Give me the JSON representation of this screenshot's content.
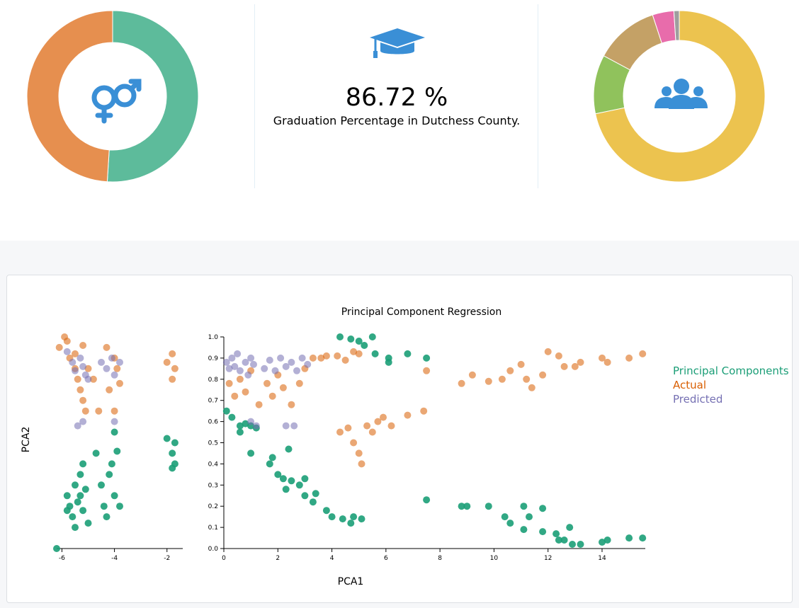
{
  "colors": {
    "gender_male": "#5dbb9b",
    "gender_female": "#e68f4f",
    "icon_blue": "#3a8fd6",
    "pc": "#1b9e77",
    "actual": "#d95f02",
    "predicted": "#7570b3"
  },
  "icons": {
    "gender": "gender-male-female-icon",
    "graduation": "graduation-cap-icon",
    "population": "users-group-icon"
  },
  "gender_donut": {
    "slices": [
      {
        "value": 51,
        "color": "#5dbb9b"
      },
      {
        "value": 49,
        "color": "#e68f4f"
      }
    ]
  },
  "graduation": {
    "percentage": "86.72 %",
    "label": "Graduation Percentage in Dutchess County."
  },
  "race_donut": {
    "slices": [
      {
        "value": 71,
        "color": "#ecc34f"
      },
      {
        "value": 11,
        "color": "#90c25c"
      },
      {
        "value": 12,
        "color": "#c4a166"
      },
      {
        "value": 4,
        "color": "#e86cab"
      },
      {
        "value": 1,
        "color": "#9e9e9e"
      }
    ]
  },
  "chart_data": {
    "type": "scatter",
    "title": "Principal Component Regression",
    "xlabel": "PCA1",
    "ylabel": "PCA2",
    "legend": {
      "placement": "right",
      "entries": [
        {
          "label": "Principal Components",
          "color": "#1b9e77"
        },
        {
          "label": "Actual",
          "color": "#d95f02"
        },
        {
          "label": "Predicted",
          "color": "#7570b3"
        }
      ]
    },
    "left_panel": {
      "xlim": [
        -6.2,
        -1.4
      ],
      "xticks": [
        "-6",
        "-4",
        "-2"
      ]
    },
    "right_panel": {
      "xlim": [
        0,
        15.6
      ],
      "ylim": [
        0,
        1.0
      ],
      "xticks": [
        "0",
        "2",
        "4",
        "6",
        "8",
        "10",
        "12",
        "14"
      ],
      "yticks": [
        "0.0",
        "0.1",
        "0.2",
        "0.3",
        "0.4",
        "0.5",
        "0.6",
        "0.7",
        "0.8",
        "0.9",
        "1.0"
      ]
    },
    "series": [
      {
        "name": "Principal Components",
        "color": "#1b9e77",
        "points": [
          [
            -6.2,
            0.0
          ],
          [
            -5.8,
            0.25
          ],
          [
            -5.7,
            0.2
          ],
          [
            -5.6,
            0.15
          ],
          [
            -5.5,
            0.3
          ],
          [
            -5.4,
            0.22
          ],
          [
            -5.3,
            0.35
          ],
          [
            -5.2,
            0.18
          ],
          [
            -5.1,
            0.28
          ],
          [
            -5.0,
            0.12
          ],
          [
            -5.2,
            0.4
          ],
          [
            -5.5,
            0.1
          ],
          [
            -5.8,
            0.18
          ],
          [
            -5.3,
            0.25
          ],
          [
            -4.7,
            0.45
          ],
          [
            -4.5,
            0.3
          ],
          [
            -4.4,
            0.2
          ],
          [
            -4.2,
            0.35
          ],
          [
            -4.0,
            0.55
          ],
          [
            -4.0,
            0.25
          ],
          [
            -3.9,
            0.46
          ],
          [
            -3.8,
            0.2
          ],
          [
            -4.1,
            0.4
          ],
          [
            -4.3,
            0.15
          ],
          [
            -2.0,
            0.52
          ],
          [
            -1.8,
            0.45
          ],
          [
            -1.8,
            0.38
          ],
          [
            -1.7,
            0.5
          ],
          [
            -1.7,
            0.4
          ],
          [
            0.1,
            0.65
          ],
          [
            0.3,
            0.62
          ],
          [
            0.6,
            0.58
          ],
          [
            0.8,
            0.59
          ],
          [
            1.0,
            0.58
          ],
          [
            1.2,
            0.57
          ],
          [
            0.6,
            0.55
          ],
          [
            1.0,
            0.45
          ],
          [
            1.7,
            0.4
          ],
          [
            1.8,
            0.43
          ],
          [
            2.0,
            0.35
          ],
          [
            2.2,
            0.33
          ],
          [
            2.3,
            0.28
          ],
          [
            2.5,
            0.32
          ],
          [
            2.4,
            0.47
          ],
          [
            2.8,
            0.3
          ],
          [
            3.0,
            0.25
          ],
          [
            3.0,
            0.33
          ],
          [
            3.3,
            0.22
          ],
          [
            3.4,
            0.26
          ],
          [
            3.8,
            0.18
          ],
          [
            4.0,
            0.15
          ],
          [
            4.4,
            0.14
          ],
          [
            4.7,
            0.12
          ],
          [
            4.8,
            0.15
          ],
          [
            5.1,
            0.14
          ],
          [
            4.3,
            1.0
          ],
          [
            4.7,
            0.99
          ],
          [
            5.0,
            0.98
          ],
          [
            5.2,
            0.96
          ],
          [
            5.5,
            1.0
          ],
          [
            5.6,
            0.92
          ],
          [
            6.1,
            0.9
          ],
          [
            6.1,
            0.88
          ],
          [
            6.8,
            0.92
          ],
          [
            7.5,
            0.9
          ],
          [
            7.5,
            0.23
          ],
          [
            8.8,
            0.2
          ],
          [
            9.0,
            0.2
          ],
          [
            9.8,
            0.2
          ],
          [
            10.4,
            0.15
          ],
          [
            10.6,
            0.12
          ],
          [
            11.1,
            0.2
          ],
          [
            11.1,
            0.09
          ],
          [
            11.3,
            0.15
          ],
          [
            11.8,
            0.19
          ],
          [
            11.8,
            0.08
          ],
          [
            12.3,
            0.07
          ],
          [
            12.4,
            0.04
          ],
          [
            12.6,
            0.04
          ],
          [
            12.8,
            0.1
          ],
          [
            13.2,
            0.02
          ],
          [
            12.9,
            0.02
          ],
          [
            14.0,
            0.03
          ],
          [
            14.2,
            0.04
          ],
          [
            15.0,
            0.05
          ],
          [
            15.5,
            0.05
          ]
        ]
      },
      {
        "name": "Actual",
        "color": "#d95f02",
        "points": [
          [
            -6.1,
            0.95
          ],
          [
            -5.9,
            1.0
          ],
          [
            -5.8,
            0.98
          ],
          [
            -5.7,
            0.9
          ],
          [
            -5.5,
            0.85
          ],
          [
            -5.4,
            0.8
          ],
          [
            -5.3,
            0.75
          ],
          [
            -5.2,
            0.7
          ],
          [
            -5.1,
            0.65
          ],
          [
            -5.0,
            0.85
          ],
          [
            -5.5,
            0.92
          ],
          [
            -5.2,
            0.96
          ],
          [
            -4.8,
            0.8
          ],
          [
            -4.6,
            0.65
          ],
          [
            -4.3,
            0.95
          ],
          [
            -4.0,
            0.9
          ],
          [
            -3.9,
            0.85
          ],
          [
            -4.2,
            0.75
          ],
          [
            -4.0,
            0.65
          ],
          [
            -3.8,
            0.78
          ],
          [
            -2.0,
            0.88
          ],
          [
            -1.8,
            0.92
          ],
          [
            -1.7,
            0.85
          ],
          [
            -1.8,
            0.8
          ],
          [
            0.2,
            0.78
          ],
          [
            0.4,
            0.72
          ],
          [
            0.6,
            0.8
          ],
          [
            0.8,
            0.74
          ],
          [
            1.0,
            0.84
          ],
          [
            1.3,
            0.68
          ],
          [
            1.6,
            0.78
          ],
          [
            1.8,
            0.72
          ],
          [
            2.0,
            0.82
          ],
          [
            2.2,
            0.76
          ],
          [
            2.5,
            0.68
          ],
          [
            2.8,
            0.78
          ],
          [
            3.0,
            0.85
          ],
          [
            3.3,
            0.9
          ],
          [
            3.6,
            0.9
          ],
          [
            3.8,
            0.91
          ],
          [
            4.2,
            0.91
          ],
          [
            4.5,
            0.89
          ],
          [
            4.8,
            0.93
          ],
          [
            5.0,
            0.92
          ],
          [
            4.3,
            0.55
          ],
          [
            4.6,
            0.57
          ],
          [
            4.8,
            0.5
          ],
          [
            5.0,
            0.45
          ],
          [
            5.1,
            0.4
          ],
          [
            5.3,
            0.58
          ],
          [
            5.5,
            0.55
          ],
          [
            5.7,
            0.6
          ],
          [
            5.9,
            0.62
          ],
          [
            6.2,
            0.58
          ],
          [
            6.8,
            0.63
          ],
          [
            7.4,
            0.65
          ],
          [
            7.5,
            0.84
          ],
          [
            8.8,
            0.78
          ],
          [
            9.2,
            0.82
          ],
          [
            9.8,
            0.79
          ],
          [
            10.3,
            0.8
          ],
          [
            10.6,
            0.84
          ],
          [
            11.0,
            0.87
          ],
          [
            11.2,
            0.8
          ],
          [
            11.4,
            0.76
          ],
          [
            11.8,
            0.82
          ],
          [
            12.0,
            0.93
          ],
          [
            12.4,
            0.91
          ],
          [
            12.6,
            0.86
          ],
          [
            13.0,
            0.86
          ],
          [
            13.2,
            0.88
          ],
          [
            14.0,
            0.9
          ],
          [
            14.2,
            0.88
          ],
          [
            15.0,
            0.9
          ],
          [
            15.5,
            0.92
          ]
        ]
      },
      {
        "name": "Predicted",
        "color": "#7570b3",
        "points": [
          [
            -5.8,
            0.93
          ],
          [
            -5.6,
            0.88
          ],
          [
            -5.5,
            0.84
          ],
          [
            -5.3,
            0.9
          ],
          [
            -5.2,
            0.86
          ],
          [
            -5.1,
            0.82
          ],
          [
            -5.0,
            0.8
          ],
          [
            -5.2,
            0.6
          ],
          [
            -5.4,
            0.58
          ],
          [
            -4.5,
            0.88
          ],
          [
            -4.3,
            0.85
          ],
          [
            -4.1,
            0.9
          ],
          [
            -4.0,
            0.82
          ],
          [
            -4.0,
            0.6
          ],
          [
            -3.8,
            0.88
          ],
          [
            0.1,
            0.88
          ],
          [
            0.2,
            0.85
          ],
          [
            0.3,
            0.9
          ],
          [
            0.4,
            0.86
          ],
          [
            0.5,
            0.92
          ],
          [
            0.6,
            0.84
          ],
          [
            0.8,
            0.88
          ],
          [
            0.9,
            0.82
          ],
          [
            1.0,
            0.9
          ],
          [
            1.1,
            0.87
          ],
          [
            1.5,
            0.85
          ],
          [
            1.7,
            0.89
          ],
          [
            1.9,
            0.84
          ],
          [
            2.1,
            0.9
          ],
          [
            2.3,
            0.86
          ],
          [
            2.5,
            0.88
          ],
          [
            2.7,
            0.84
          ],
          [
            2.9,
            0.9
          ],
          [
            3.1,
            0.87
          ],
          [
            1.2,
            0.58
          ],
          [
            1.0,
            0.6
          ],
          [
            2.3,
            0.58
          ],
          [
            2.6,
            0.58
          ]
        ]
      }
    ]
  }
}
